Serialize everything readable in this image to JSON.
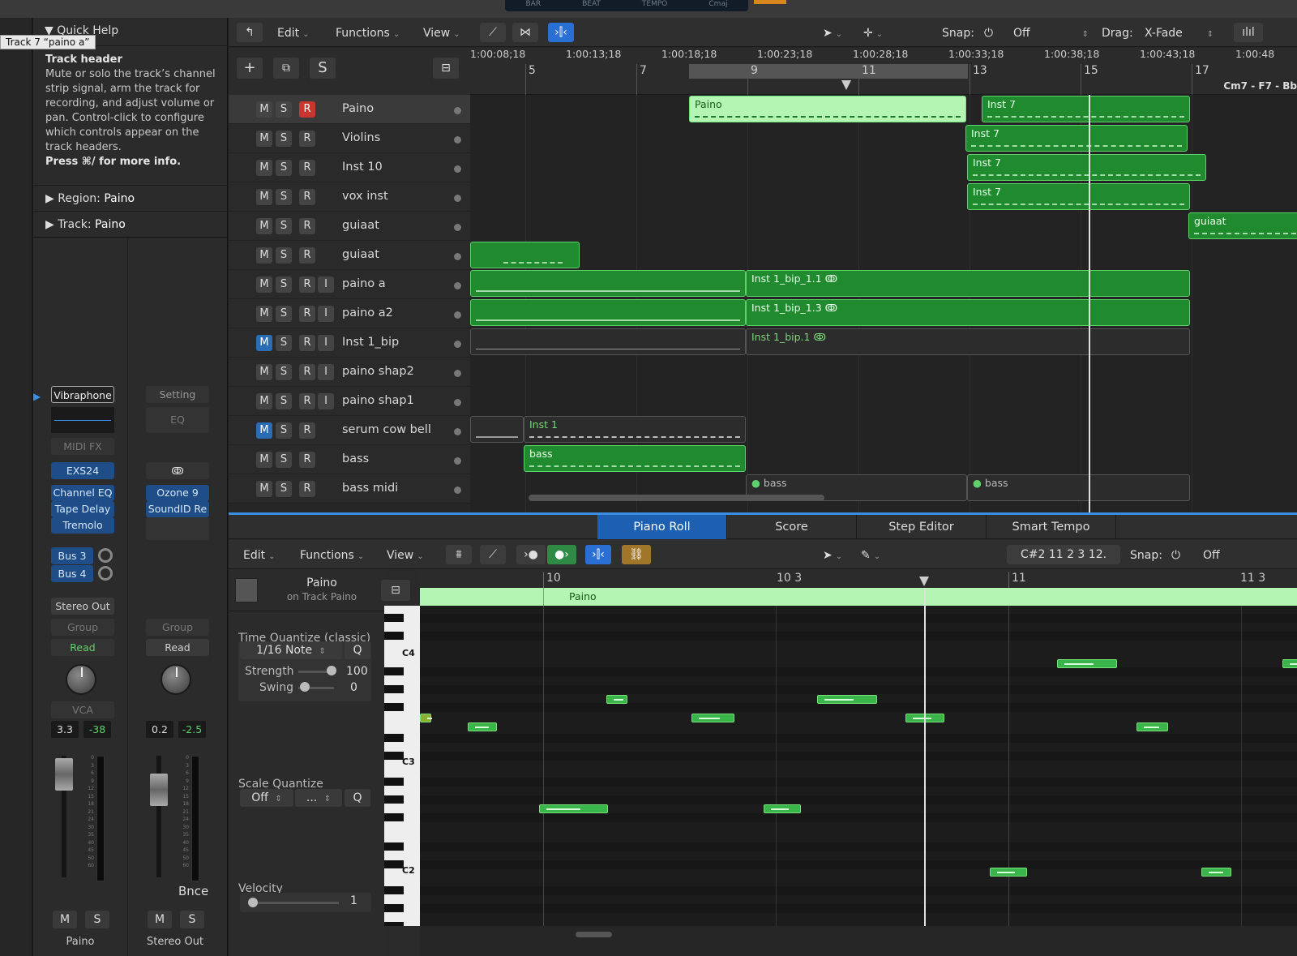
{
  "lcd": {
    "labels": [
      "BAR",
      "BEAT",
      "TEMPO"
    ],
    "key": "Cmaj"
  },
  "tooltip": "Track 7 “paino a”",
  "quick_help": {
    "title": "Quick Help",
    "heading": "Track header",
    "body": "Mute or solo the track’s channel strip signal, arm the track for recording, and adjust volume or pan. Control-click to configure which controls appear on the track headers.",
    "more": "Press ⌘/ for more info."
  },
  "region_disclose": {
    "label": "Region:",
    "value": "Paino"
  },
  "track_disclose": {
    "label": "Track:",
    "value": "Paino"
  },
  "channel1": {
    "instrument": "Vibraphone",
    "midi_fx": "MIDI FX",
    "instrument_plugin": "EXS24",
    "plugins": [
      "Channel EQ",
      "Tape Delay",
      "Tremolo"
    ],
    "sends": [
      "Bus 3",
      "Bus 4"
    ],
    "output": "Stereo Out",
    "group": "Group",
    "automation": "Read",
    "vca": "VCA",
    "volume": "3.3",
    "peak": "-38",
    "mute": "M",
    "solo": "S",
    "name": "Paino",
    "meter_scale": [
      "0",
      "3",
      "6",
      "9",
      "12",
      "15",
      "18",
      "21",
      "24",
      "30",
      "35",
      "40",
      "45",
      "50",
      "60"
    ]
  },
  "channel2": {
    "setting": "Setting",
    "eq": "EQ",
    "link_icon": "ↂ",
    "plugins": [
      "Ozone 9",
      "SoundID Re"
    ],
    "group": "Group",
    "automation": "Read",
    "volume": "0.2",
    "peak": "-2.5",
    "bounce": "Bnce",
    "mute": "M",
    "solo": "S",
    "name": "Stereo Out",
    "meter_scale": [
      "0",
      "3",
      "6",
      "9",
      "12",
      "15",
      "18",
      "21",
      "24",
      "30",
      "35",
      "40",
      "45",
      "50",
      "60"
    ]
  },
  "tracks_toolbar": {
    "edit": "Edit",
    "functions": "Functions",
    "view": "View",
    "snap_label": "Snap:",
    "snap_value": "Off",
    "drag_label": "Drag:",
    "drag_value": "X-Fade"
  },
  "ruler": {
    "timecodes": [
      "1:00:08;18",
      "1:00:13;18",
      "1:00:18;18",
      "1:00:23;18",
      "1:00:28;18",
      "1:00:33;18",
      "1:00:38;18",
      "1:00:43;18",
      "1:00:48"
    ],
    "bars": [
      "5",
      "7",
      "9",
      "11",
      "13",
      "15",
      "17"
    ],
    "chord": "Cm7 - F7 - Bb"
  },
  "tracks": [
    {
      "name": "Paino",
      "rec": "R"
    },
    {
      "name": "Violins",
      "rec": "R"
    },
    {
      "name": "Inst 10",
      "rec": "R"
    },
    {
      "name": "vox inst",
      "rec": "R"
    },
    {
      "name": "guiaat",
      "rec": "R"
    },
    {
      "name": "guiaat",
      "rec": "R"
    },
    {
      "name": "paino a",
      "rec": "R",
      "input": "I"
    },
    {
      "name": "paino a2",
      "rec": "R",
      "input": "I"
    },
    {
      "name": "Inst 1_bip",
      "rec": "R",
      "input": "I"
    },
    {
      "name": "paino shap2",
      "rec": "R",
      "input": "I"
    },
    {
      "name": "paino shap1",
      "rec": "R",
      "input": "I"
    },
    {
      "name": "serum cow bell",
      "rec": "R"
    },
    {
      "name": "bass",
      "rec": "R"
    },
    {
      "name": "bass midi",
      "rec": "R"
    }
  ],
  "track_button_labels": {
    "mute": "M",
    "solo": "S"
  },
  "regions": {
    "paino": "Paino",
    "inst7": "Inst 7",
    "guiaat": "guiaat",
    "bip11": "Inst 1_bip_1.1",
    "bip13": "Inst 1_bip_1.3",
    "bip1": "Inst 1_bip.1",
    "inst1": "Inst 1",
    "bass": "bass"
  },
  "piano_roll": {
    "tabs": [
      "Piano Roll",
      "Score",
      "Step Editor",
      "Smart Tempo"
    ],
    "edit": "Edit",
    "functions": "Functions",
    "view": "View",
    "position": "C#2   11 2 3 12.",
    "snap_label": "Snap:",
    "snap_value": "Off",
    "region_name": "Paino",
    "region_track": "on Track Paino",
    "time_quantize_label": "Time Quantize (classic)",
    "quantize_value": "1/16 Note",
    "q": "Q",
    "strength_label": "Strength",
    "strength_value": "100",
    "swing_label": "Swing",
    "swing_value": "0",
    "scale_quantize_label": "Scale Quantize",
    "scale_value": "Off",
    "scale_value2": "...",
    "velocity_label": "Velocity",
    "velocity_value": "1",
    "bars": [
      "10",
      "10 3",
      "11",
      "11 3"
    ],
    "region_label": "Paino",
    "key_labels": [
      "C4",
      "C3",
      "C2"
    ]
  }
}
